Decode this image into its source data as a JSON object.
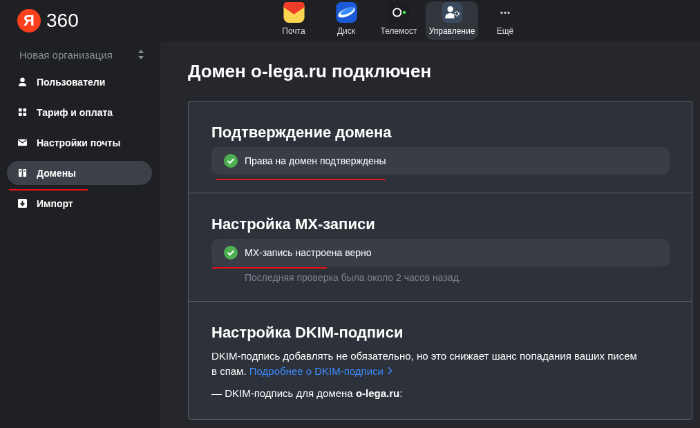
{
  "topbar": {
    "logo_letter": "Я",
    "logo_number": "360",
    "apps": [
      {
        "label": "Почта",
        "kind": "mail",
        "selected": false
      },
      {
        "label": "Диск",
        "kind": "disk",
        "selected": false
      },
      {
        "label": "Телемост",
        "kind": "telemost",
        "selected": false
      },
      {
        "label": "Управление",
        "kind": "admin",
        "selected": true
      },
      {
        "label": "Ещё",
        "kind": "more",
        "selected": false
      }
    ]
  },
  "sidebar": {
    "organization": "Новая организация",
    "items": [
      {
        "label": "Пользователи",
        "kind": "user",
        "selected": false
      },
      {
        "label": "Тариф и оплата",
        "kind": "grid",
        "selected": false
      },
      {
        "label": "Настройки почты",
        "kind": "mail",
        "selected": false
      },
      {
        "label": "Домены",
        "kind": "domain",
        "selected": true
      },
      {
        "label": "Импорт",
        "kind": "import",
        "selected": false
      }
    ]
  },
  "page": {
    "title": "Домен o-lega.ru подключен",
    "sections": [
      {
        "title": "Подтверждение домена",
        "status": "Права на домен подтверждены",
        "ok": true
      },
      {
        "title": "Настройка MX-записи",
        "status": "MX-запись настроена верно",
        "ok": true,
        "note": "Последняя проверка была около 2 часов назад."
      },
      {
        "title": "Настройка DKIM-подписи",
        "text": "DKIM-подпись добавлять не обязательно, но это снижает шанс попадания ваших писем в спам.",
        "link": "Подробнее о DKIM-подписи",
        "line": "— DKIM-подпись для домена **o-lega.ru**:"
      }
    ]
  }
}
